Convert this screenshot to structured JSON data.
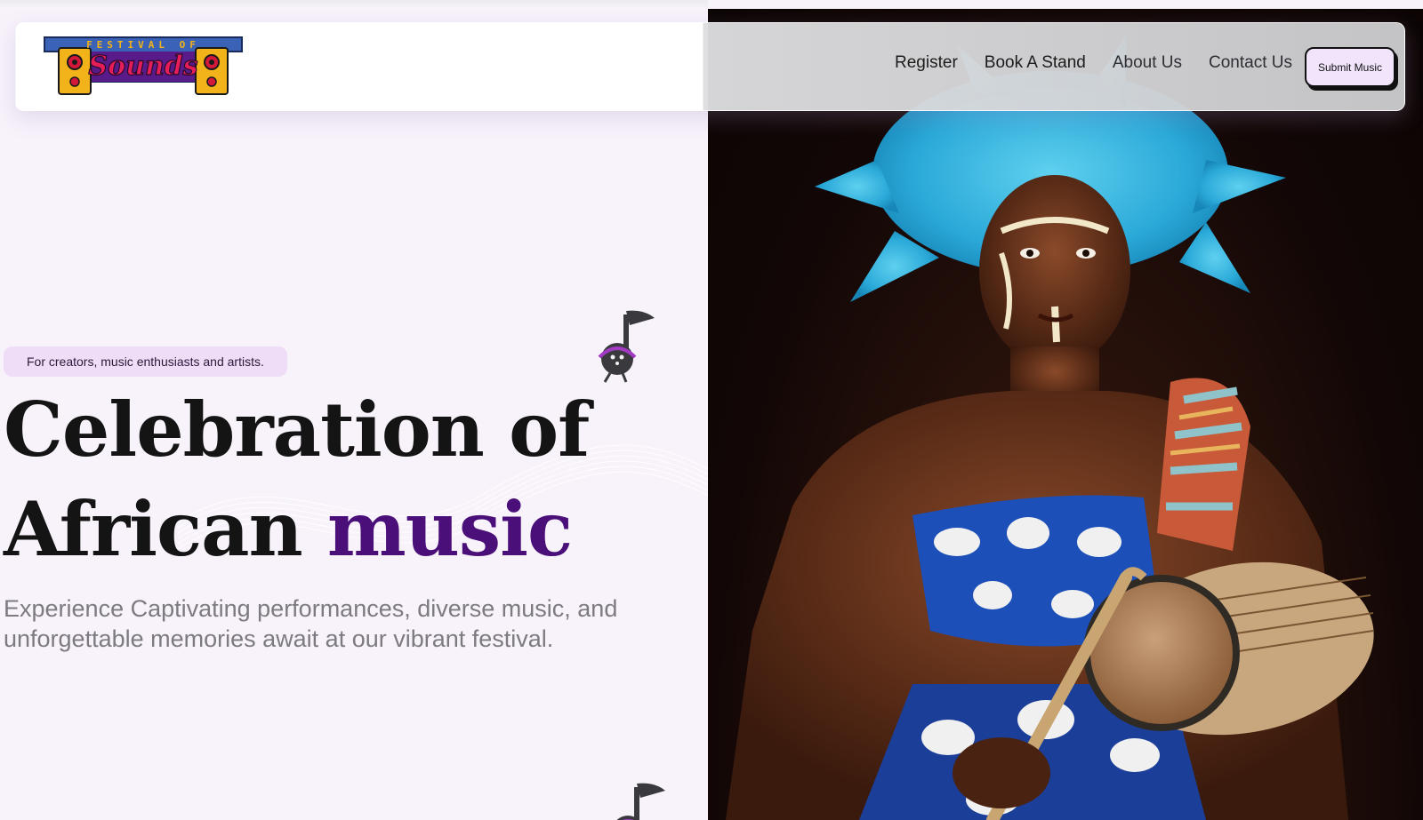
{
  "brand": {
    "logo_top": "FESTIVAL OF",
    "logo_main": "Sounds",
    "colors": {
      "accent": "#4b0f7a",
      "pill_bg": "#efdcf7",
      "page_bg": "#f8f2fb",
      "button_bg": "#f2e4fb"
    }
  },
  "nav": {
    "links": [
      {
        "label": "Register"
      },
      {
        "label": "Book A Stand"
      },
      {
        "label": "About Us"
      },
      {
        "label": "Contact Us"
      }
    ],
    "cta_label": "Submit Music"
  },
  "hero": {
    "tagline": "For creators, music enthusiasts and artists.",
    "headline_line1": "Celebration of",
    "headline_line2_part1": "African",
    "headline_line2_accent": "music",
    "subtext": "Experience Captivating performances, diverse music, and unforgettable memories await at our vibrant festival.",
    "icons": [
      "music-note-mascot-icon",
      "music-note-mascot-icon"
    ],
    "image": "performer-with-blue-feather-headdress-and-drum"
  }
}
